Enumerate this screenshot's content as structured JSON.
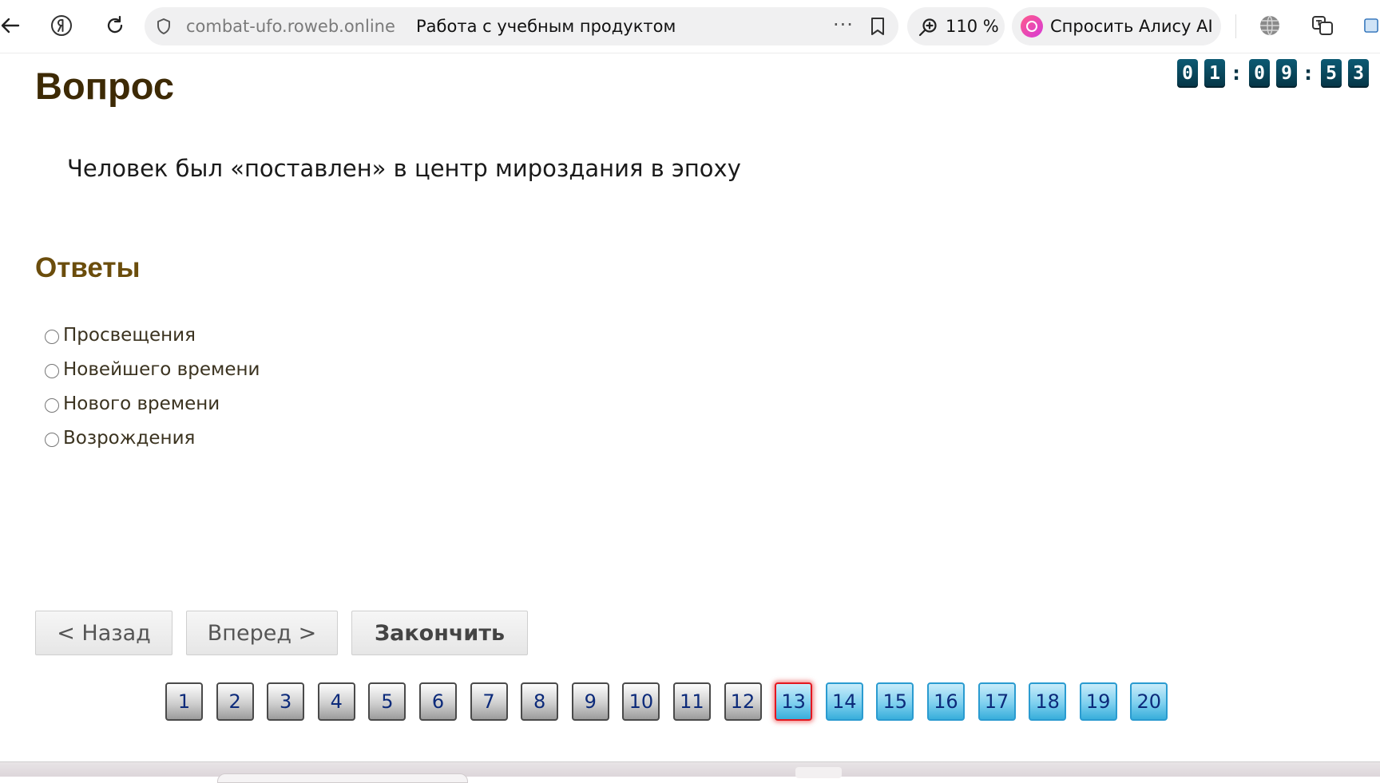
{
  "browser": {
    "host": "combat-ufo.roweb.online",
    "page_title": "Работа с учебным продуктом",
    "more_label": "···",
    "zoom": "110 %",
    "alice_label": "Спросить Алису AI",
    "icons": [
      "back-arrow-icon",
      "yandex-icon",
      "reload-icon",
      "shield-icon",
      "bookmark-icon",
      "zoom-icon",
      "alice-icon",
      "globe-icon",
      "translate-icon",
      "extension-icon"
    ]
  },
  "timer": {
    "h1": "0",
    "h2": "1",
    "sep1": ":",
    "m1": "0",
    "m2": "9",
    "sep2": ":",
    "s1": "5",
    "s2": "3"
  },
  "question": {
    "heading": "Вопрос",
    "text": "Человек был «поставлен» в центр мироздания в эпоху"
  },
  "answers": {
    "heading": "Ответы",
    "options": [
      "Просвещения",
      "Новейшего времени",
      "Нового времени",
      "Возрождения"
    ]
  },
  "buttons": {
    "back": "< Назад",
    "forward": "Вперед >",
    "finish": "Закончить"
  },
  "pager": {
    "numbers": [
      "1",
      "2",
      "3",
      "4",
      "5",
      "6",
      "7",
      "8",
      "9",
      "10",
      "11",
      "12",
      "13",
      "14",
      "15",
      "16",
      "17",
      "18",
      "19",
      "20"
    ],
    "current": "13",
    "answered_through": "12",
    "colors": {
      "answered": "#9c9c9c",
      "pending": "#38aedb",
      "current_border": "#e4171f"
    }
  }
}
